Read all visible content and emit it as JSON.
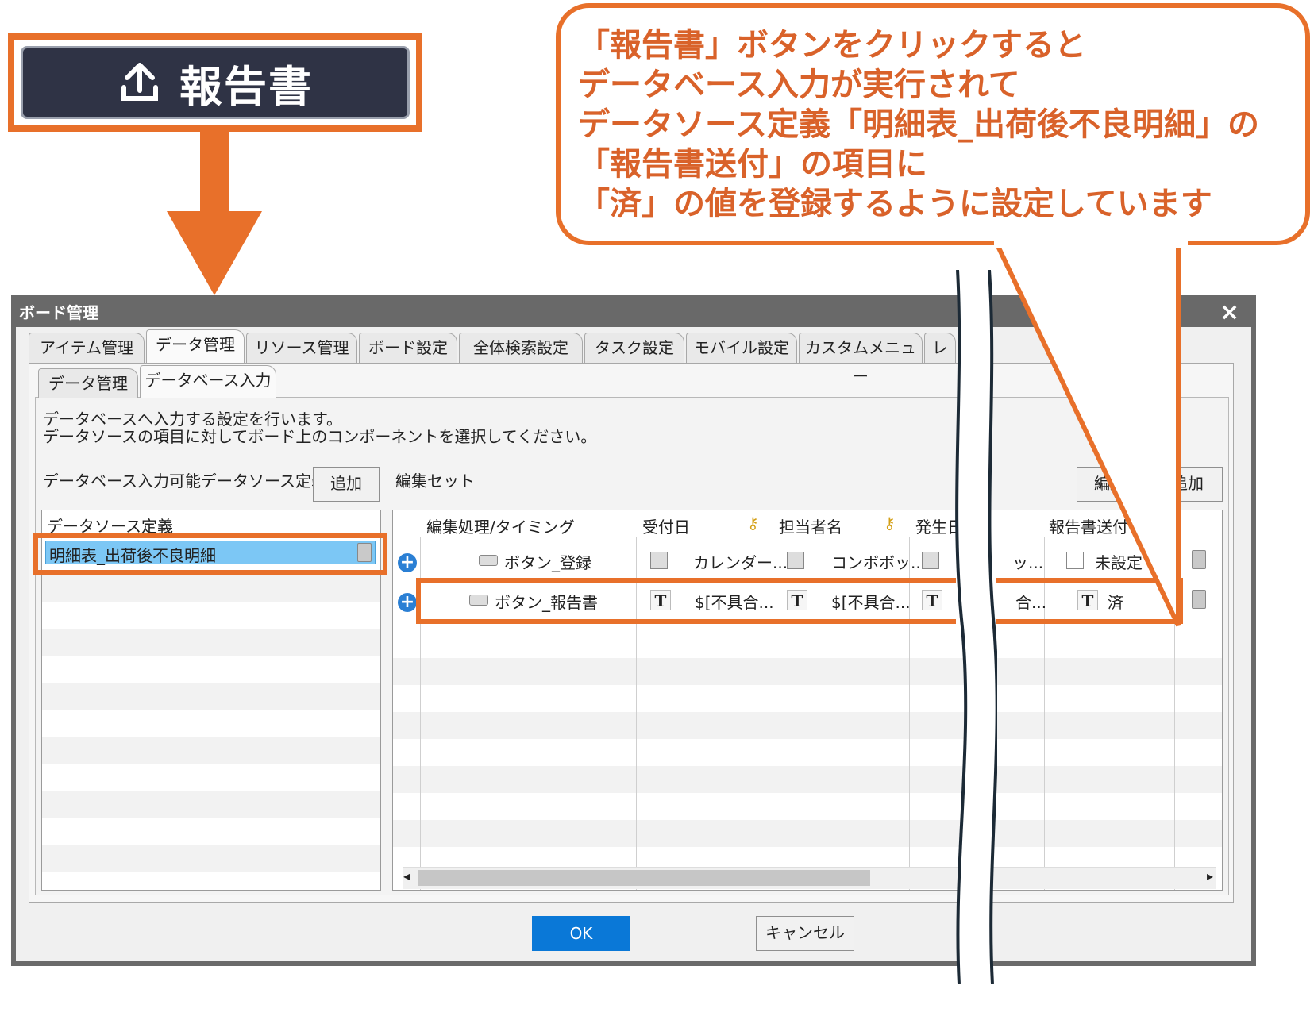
{
  "callout_button": {
    "label": "報告書",
    "icon": "upload-icon"
  },
  "bubble": {
    "text": "「報告書」ボタンをクリックすると\nデータベース入力が実行されて\nデータソース定義「明細表_出荷後不良明細」の\n「報告書送付」の項目に\n「済」の値を登録するように設定しています"
  },
  "dialog": {
    "title": "ボード管理",
    "close": "×",
    "tabs": [
      "アイテム管理",
      "データ管理",
      "リソース管理",
      "ボード設定",
      "全体検索設定",
      "タスク設定",
      "モバイル設定",
      "カスタムメニュー",
      "レポ"
    ],
    "subtabs": [
      "データ管理",
      "データベース入力"
    ],
    "description_line1": "データベースへ入力する設定を行います。",
    "description_line2": "データソースの項目に対してボード上のコンポーネントを選択してください。",
    "left_section_label": "データベース入力可能データソース定義",
    "left_add_button": "追加",
    "right_section_label": "編集セット",
    "edit_button": "編集",
    "right_add_button": "追加",
    "left_list": {
      "header": "データソース定義",
      "items": [
        "明細表_出荷後不良明細"
      ]
    },
    "grid": {
      "headers": [
        "編集処理/タイミング",
        "受付日",
        "担当者名",
        "発生日",
        "報告書送付"
      ],
      "rows": [
        {
          "timing": "ボタン_登録",
          "c1": "カレンダー...",
          "c2": "コンボボッ...",
          "c3": "ッ...",
          "c4": "未設定"
        },
        {
          "timing": "ボタン_報告書",
          "c1": "$[不具合...",
          "c2": "$[不具合...",
          "c3": "合...",
          "c4": "済"
        }
      ]
    },
    "ok": "OK",
    "cancel": "キャンセル"
  },
  "colors": {
    "accent": "#e8702a",
    "dark_button": "#2f3345",
    "ok_blue": "#0a78d7",
    "selection": "#7cc7f5"
  }
}
